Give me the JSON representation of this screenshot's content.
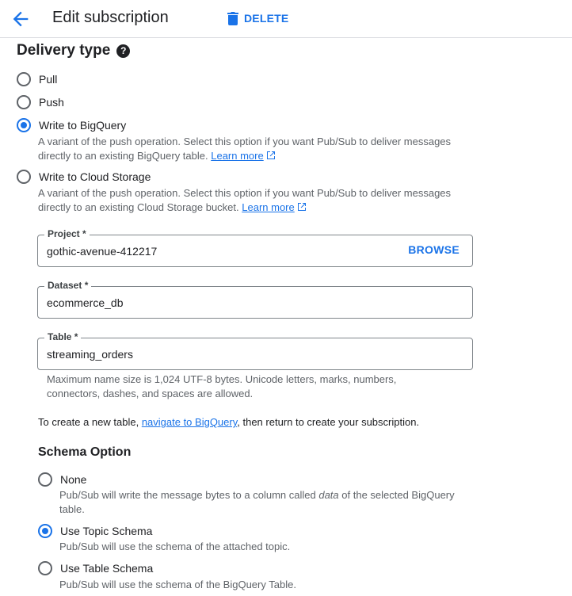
{
  "header": {
    "title": "Edit subscription",
    "back_icon": "arrow-left-icon",
    "delete_label": "DELETE",
    "delete_icon": "trash-icon",
    "accent_color": "#1a73e8"
  },
  "delivery_type": {
    "title": "Delivery type",
    "help_icon": "help-circle-icon",
    "help_glyph": "?",
    "options": [
      {
        "label": "Pull",
        "selected": false
      },
      {
        "label": "Push",
        "selected": false
      },
      {
        "label": "Write to BigQuery",
        "selected": true,
        "desc_line1": "A variant of the push operation. Select this option if you want Pub/Sub to deliver messages",
        "desc_line2": "directly to an existing BigQuery table.",
        "learn_more": "Learn more"
      },
      {
        "label": "Write to Cloud Storage",
        "selected": false,
        "desc_line1": "A variant of the push operation. Select this option if you want Pub/Sub to deliver messages",
        "desc_line2": "directly to an existing Cloud Storage bucket.",
        "learn_more": "Learn more"
      }
    ]
  },
  "fields": {
    "project": {
      "label": "Project *",
      "value": "gothic-avenue-412217",
      "browse": "BROWSE"
    },
    "dataset": {
      "label": "Dataset *",
      "value": "ecommerce_db"
    },
    "table": {
      "label": "Table *",
      "value": "streaming_orders",
      "hint_line1": "Maximum name size is 1,024 UTF-8 bytes. Unicode letters, marks, numbers,",
      "hint_line2": "connectors, dashes, and spaces are allowed."
    }
  },
  "create_table": {
    "prefix": "To create a new table, ",
    "link": "navigate to BigQuery",
    "suffix": ", then return to create your subscription."
  },
  "schema": {
    "title": "Schema Option",
    "options": [
      {
        "label": "None",
        "selected": false,
        "desc_pre": "Pub/Sub will write the message bytes to a column called ",
        "desc_em": "data",
        "desc_post": " of the selected BigQuery",
        "desc_line2": "table."
      },
      {
        "label": "Use Topic Schema",
        "selected": true,
        "desc": "Pub/Sub will use the schema of the attached topic."
      },
      {
        "label": "Use Table Schema",
        "selected": false,
        "desc": "Pub/Sub will use the schema of the BigQuery Table."
      }
    ]
  }
}
